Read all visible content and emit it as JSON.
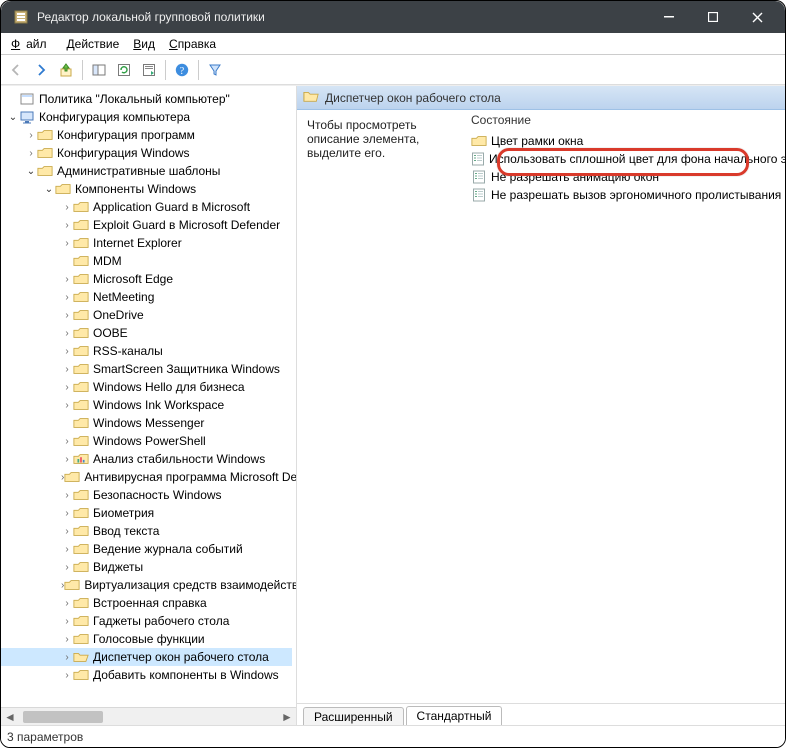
{
  "title": "Редактор локальной групповой политики",
  "menus": {
    "file": "Файл",
    "action": "Действие",
    "view": "Вид",
    "help": "Справка"
  },
  "toolbar_icons": [
    "back",
    "forward",
    "up",
    "sep",
    "show",
    "refresh",
    "export",
    "sep2",
    "help",
    "sep3",
    "filter"
  ],
  "tree_root": "Политика \"Локальный компьютер\"",
  "tree": [
    {
      "level": 0,
      "expander": "",
      "icon": "policy-root",
      "label": "Политика \"Локальный компьютер\""
    },
    {
      "level": 0,
      "expander": "open",
      "icon": "computer",
      "label": "Конфигурация компьютера"
    },
    {
      "level": 1,
      "expander": "closed",
      "icon": "folder",
      "label": "Конфигурация программ"
    },
    {
      "level": 1,
      "expander": "closed",
      "icon": "folder",
      "label": "Конфигурация Windows"
    },
    {
      "level": 1,
      "expander": "open",
      "icon": "folder",
      "label": "Административные шаблоны"
    },
    {
      "level": 2,
      "expander": "open",
      "icon": "folder",
      "label": "Компоненты Windows"
    },
    {
      "level": 3,
      "expander": "closed",
      "icon": "folder",
      "label": "Application Guard в Microsoft"
    },
    {
      "level": 3,
      "expander": "closed",
      "icon": "folder",
      "label": "Exploit Guard в Microsoft Defender"
    },
    {
      "level": 3,
      "expander": "closed",
      "icon": "folder",
      "label": "Internet Explorer"
    },
    {
      "level": 3,
      "expander": "",
      "icon": "folder",
      "label": "MDM"
    },
    {
      "level": 3,
      "expander": "closed",
      "icon": "folder",
      "label": "Microsoft Edge"
    },
    {
      "level": 3,
      "expander": "closed",
      "icon": "folder",
      "label": "NetMeeting"
    },
    {
      "level": 3,
      "expander": "closed",
      "icon": "folder",
      "label": "OneDrive"
    },
    {
      "level": 3,
      "expander": "closed",
      "icon": "folder",
      "label": "OOBE"
    },
    {
      "level": 3,
      "expander": "closed",
      "icon": "folder",
      "label": "RSS-каналы"
    },
    {
      "level": 3,
      "expander": "closed",
      "icon": "folder",
      "label": "SmartScreen Защитника Windows"
    },
    {
      "level": 3,
      "expander": "closed",
      "icon": "folder",
      "label": "Windows Hello для бизнеса"
    },
    {
      "level": 3,
      "expander": "closed",
      "icon": "folder",
      "label": "Windows Ink Workspace"
    },
    {
      "level": 3,
      "expander": "",
      "icon": "folder",
      "label": "Windows Messenger"
    },
    {
      "level": 3,
      "expander": "closed",
      "icon": "folder",
      "label": "Windows PowerShell"
    },
    {
      "level": 3,
      "expander": "closed",
      "icon": "folder-chart",
      "label": "Анализ стабильности Windows"
    },
    {
      "level": 3,
      "expander": "closed",
      "icon": "folder",
      "label": "Антивирусная программа Microsoft Defender"
    },
    {
      "level": 3,
      "expander": "closed",
      "icon": "folder",
      "label": "Безопасность Windows"
    },
    {
      "level": 3,
      "expander": "closed",
      "icon": "folder",
      "label": "Биометрия"
    },
    {
      "level": 3,
      "expander": "closed",
      "icon": "folder",
      "label": "Ввод текста"
    },
    {
      "level": 3,
      "expander": "closed",
      "icon": "folder",
      "label": "Ведение журнала событий"
    },
    {
      "level": 3,
      "expander": "closed",
      "icon": "folder",
      "label": "Виджеты"
    },
    {
      "level": 3,
      "expander": "closed",
      "icon": "folder",
      "label": "Виртуализация средств взаимодействия"
    },
    {
      "level": 3,
      "expander": "closed",
      "icon": "folder",
      "label": "Встроенная справка"
    },
    {
      "level": 3,
      "expander": "closed",
      "icon": "folder",
      "label": "Гаджеты рабочего стола"
    },
    {
      "level": 3,
      "expander": "closed",
      "icon": "folder",
      "label": "Голосовые функции"
    },
    {
      "level": 3,
      "expander": "closed",
      "icon": "folder-open",
      "label": "Диспетчер окон рабочего стола",
      "selected": true
    },
    {
      "level": 3,
      "expander": "closed",
      "icon": "folder",
      "label": "Добавить компоненты в Windows"
    }
  ],
  "detail_header": "Диспетчер окон рабочего стола",
  "detail_hint": "Чтобы просмотреть описание элемента, выделите его.",
  "column_header": "Состояние",
  "items": [
    {
      "icon": "folder",
      "label": "Цвет рамки окна"
    },
    {
      "icon": "setting",
      "label": "Использовать сплошной цвет для фона начального экрана"
    },
    {
      "icon": "setting",
      "label": "Не разрешать анимацию окон",
      "highlight": true
    },
    {
      "icon": "setting",
      "label": "Не разрешать вызов эргономичного пролистывания"
    }
  ],
  "tabs": {
    "extended": "Расширенный",
    "standard": "Стандартный"
  },
  "status": "3 параметров"
}
